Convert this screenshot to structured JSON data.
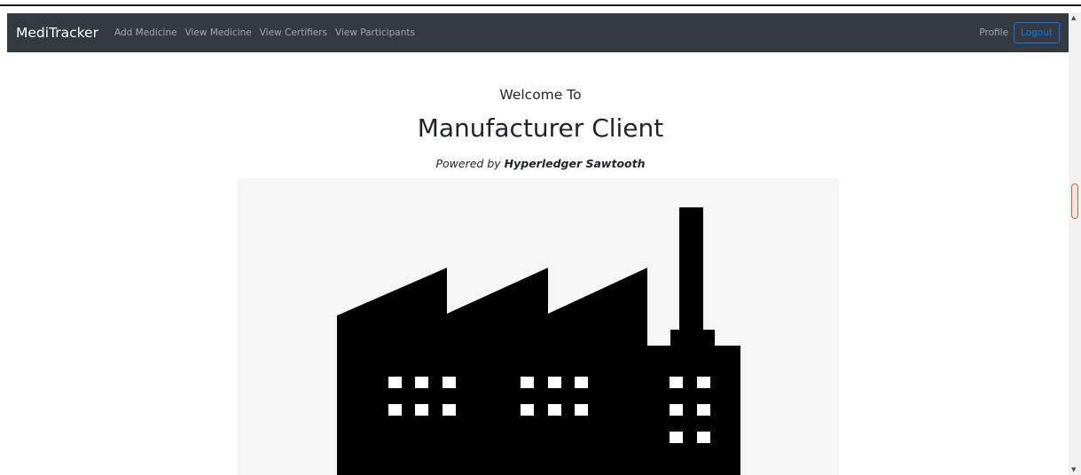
{
  "navbar": {
    "brand": "MediTracker",
    "links": [
      "Add Medicine",
      "View Medicine",
      "View Certifiers",
      "View Participants"
    ],
    "profile": "Profile",
    "logout": "Logout"
  },
  "hero": {
    "welcome": "Welcome To",
    "title": "Manufacturer Client",
    "powered_prefix": "Powered by",
    "powered_name": "Hyperledger Sawtooth"
  },
  "image": {
    "icon": "factory-icon"
  },
  "colors": {
    "navbar": "#343a40",
    "accent": "#007bff",
    "image_bg": "#f5f5f5"
  }
}
